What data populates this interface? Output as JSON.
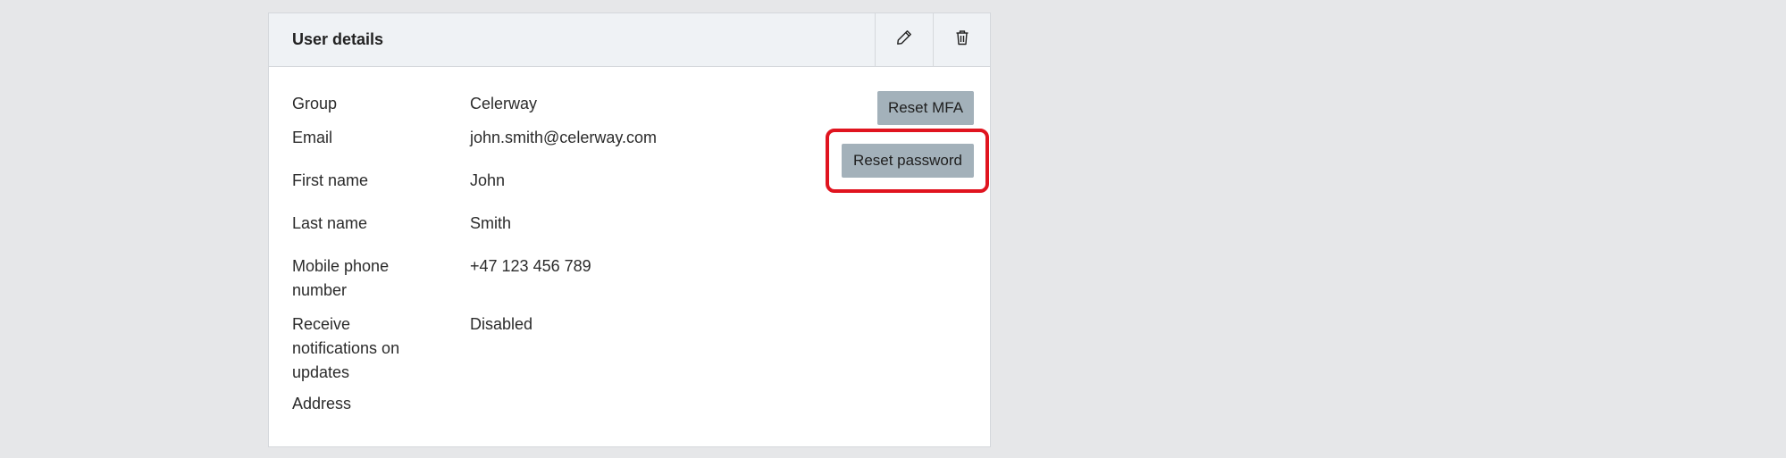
{
  "card": {
    "title": "User details",
    "edit_icon": "pencil-icon",
    "delete_icon": "trash-icon"
  },
  "details": [
    {
      "label": "Group",
      "value": "Celerway"
    },
    {
      "label": "Email",
      "value": "john.smith@celerway.com"
    },
    {
      "label": "First name",
      "value": "John"
    },
    {
      "label": "Last name",
      "value": "Smith"
    },
    {
      "label": "Mobile phone number",
      "value": "+47 123 456 789"
    },
    {
      "label": "Receive notifications on updates",
      "value": "Disabled"
    },
    {
      "label": "Address",
      "value": ""
    }
  ],
  "actions": {
    "reset_mfa_label": "Reset MFA",
    "reset_password_label": "Reset password"
  },
  "colors": {
    "page_bg": "#e6e7e9",
    "header_bg": "#eff2f5",
    "button_bg": "#a3b1ba",
    "highlight": "#e0141f"
  }
}
